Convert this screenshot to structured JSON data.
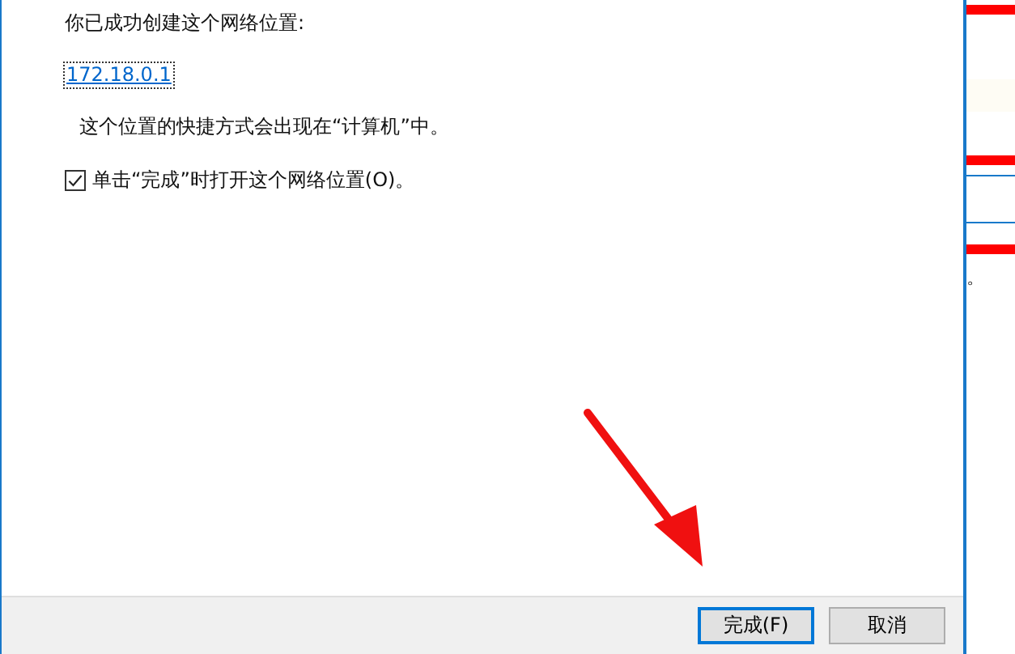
{
  "dialog": {
    "heading": "你已成功创建这个网络位置:",
    "location_link": "172.18.0.1",
    "info": "这个位置的快捷方式会出现在“计算机”中。",
    "open_option": {
      "label": "单击“完成”时打开这个网络位置(O)。",
      "checked": true
    },
    "buttons": [
      {
        "label": "完成(F)",
        "kind": "default"
      },
      {
        "label": "取消",
        "kind": "normal"
      }
    ]
  },
  "background_window": {
    "text": "。"
  }
}
